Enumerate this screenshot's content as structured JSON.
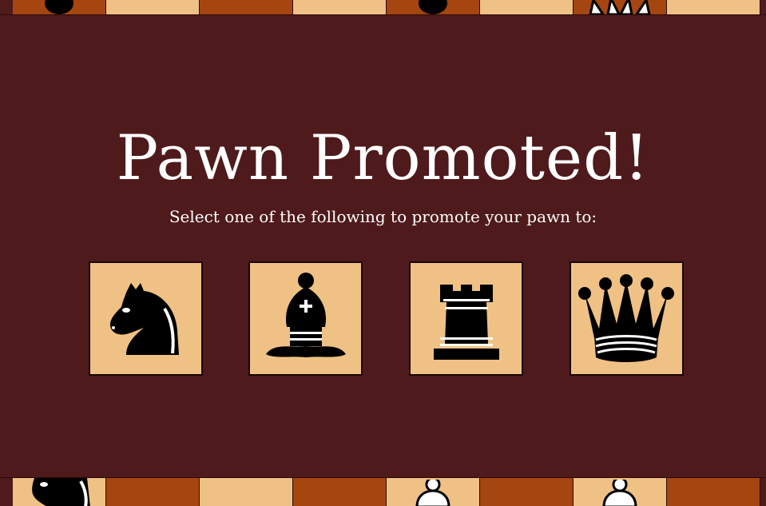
{
  "promotion_dialog": {
    "title": "Pawn Promoted!",
    "subtitle": "Select one of the following to promote your pawn to:",
    "options": [
      {
        "piece": "knight",
        "icon": "knight-icon"
      },
      {
        "piece": "bishop",
        "icon": "bishop-icon"
      },
      {
        "piece": "rook",
        "icon": "rook-icon"
      },
      {
        "piece": "queen",
        "icon": "queen-icon"
      }
    ]
  },
  "board": {
    "colors": {
      "light_square": "#f0c184",
      "dark_square": "#a5450f",
      "overlay": "#4f1a1c"
    },
    "top_row_visible_pieces": [
      "black-pawn",
      "black-pawn",
      "white-queen"
    ],
    "bottom_row_visible_pieces": [
      "black-knight",
      "white-pawn",
      "white-pawn"
    ]
  }
}
